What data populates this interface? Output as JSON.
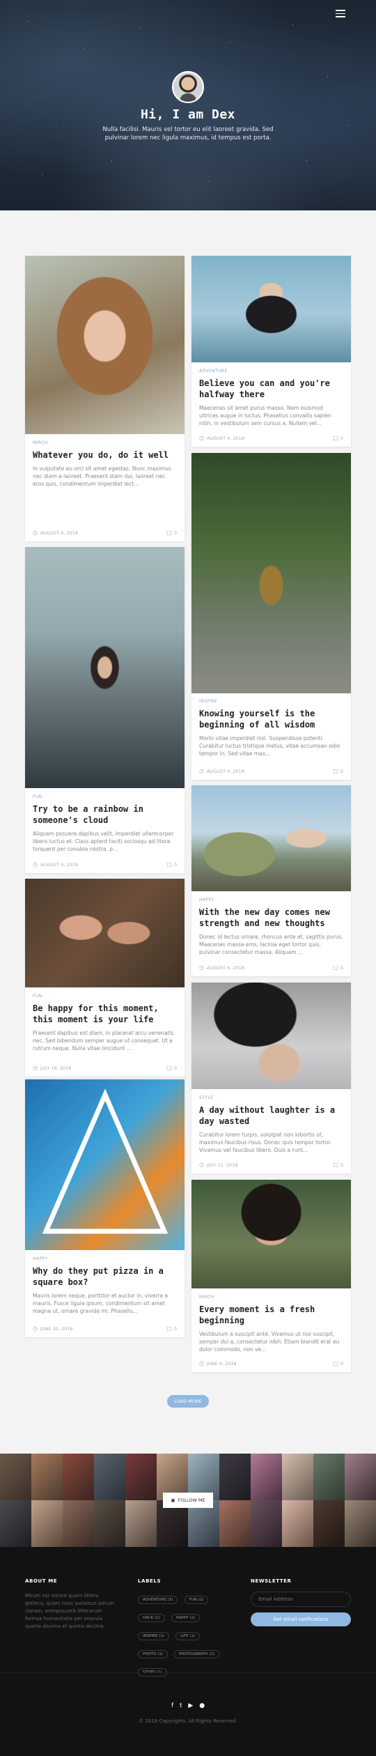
{
  "hero": {
    "title": "Hi, I am Dex",
    "subtitle": "Nulla facilisi. Mauris vel tortor eu elit laoreet gravida. Sed pulvinar lorem nec ligula maximus, id tempus est porta."
  },
  "posts": [
    {
      "tag": "Mirch",
      "title": "Whatever you do, do it well",
      "excerpt": "In vulputate eu orci sit amet egestas. Nunc maximus nec diam a laoreet. Praesent diam dui, laoreet nec eros quis, condimentum imperdiet lect...",
      "date": "August 4, 2018",
      "comments": "0"
    },
    {
      "tag": "Adventure",
      "title": "Believe you can and you're halfway there",
      "excerpt": "Maecenas sit amet purus massa. Nam euismod ultrices augue in luctus. Phasellus convallis sapien nibh, in vestibulum sem cursus a. Nullam vel...",
      "date": "August 4, 2018",
      "comments": "0"
    },
    {
      "tag": "Fun",
      "title": "Try to be a rainbow in someone's cloud",
      "excerpt": "Aliquam posuere dapibus velit, imperdiet ullamcorper libero luctus et. Class aptent taciti sociosqu ad litora torquent per conubia nostra, p...",
      "date": "August 4, 2018",
      "comments": "0"
    },
    {
      "tag": "Inspire",
      "title": "Knowing yourself is the beginning of all wisdom",
      "excerpt": "Morbi vitae imperdiet nisl. Suspendisse potenti. Curabitur luctus tristique metus, vitae accumsan odio tempor in. Sed vitae max...",
      "date": "August 4, 2018",
      "comments": "0"
    },
    {
      "tag": "Happy",
      "title": "With the new day comes new strength and new thoughts",
      "excerpt": "Donec id lectus ornare, rhoncus ante et, sagittis purus. Maecenas massa eros, lacinia eget tortor quis, pulvinar consectetur massa. Aliquam ...",
      "date": "August 4, 2018",
      "comments": "0"
    },
    {
      "tag": "Fun",
      "title": "Be happy for this moment, this moment is your life",
      "excerpt": "Praesent dapibus est diam, in placerat arcu venenatis nec. Sed bibendum semper augue ut consequat. Ut a rutrum neque. Nulla vitae tincidunt ...",
      "date": "July 18, 2018",
      "comments": "0"
    },
    {
      "tag": "Style",
      "title": "A day without laughter is a day wasted",
      "excerpt": "Curabitur lorem turpis, volutpat non lobortis ut, maximus faucibus risus. Donec quis tempor tortor. Vivamus vel faucibus libero. Duis a runt...",
      "date": "July 11, 2018",
      "comments": "0"
    },
    {
      "tag": "Happy",
      "title": "Why do they put pizza in a square box?",
      "excerpt": "Mauris lorem neque, porttitor et auctor in, viverra a mauris. Fusce ligula ipsum, condimentum sit amet magna ut, ornare gravida mi. Phasellu...",
      "date": "June 20, 2018",
      "comments": "0"
    },
    {
      "tag": "Mirch",
      "title": "Every moment is a fresh beginning",
      "excerpt": "Vestibulum a suscipit ante. Vivamus ut nisi suscipit, semper dui a, consectetur nibh. Etiam blandit erat eu dolor commodo, non ve...",
      "date": "June 4, 2018",
      "comments": "0"
    }
  ],
  "load_more": "Load more",
  "follow": "Follow me",
  "footer": {
    "about_title": "About me",
    "about_text": "Mirum est notare quam littera gothica, quam nunc putamus parum claram, anteposuerit litterarum formas humanitatis per seacula quarta decima et quinta decima.",
    "labels_title": "Labels",
    "labels": [
      "Adventure (3)",
      "Fun (2)",
      "Hack (1)",
      "Happy (2)",
      "Inspire (1)",
      "Life (1)",
      "Photo (1)",
      "Photography (1)",
      "Story (1)"
    ],
    "newsletter_title": "Newsletter",
    "email_placeholder": "Email Address",
    "subscribe_label": "Get email notifications",
    "social": [
      "f",
      "t",
      "▶",
      "●"
    ],
    "copyright": "© 2018 Copyrights. All Rights Reserved."
  }
}
